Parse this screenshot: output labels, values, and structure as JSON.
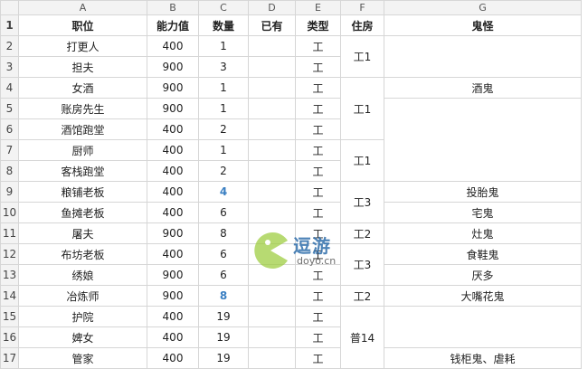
{
  "columns": [
    "A",
    "B",
    "C",
    "D",
    "E",
    "F",
    "G"
  ],
  "header": {
    "row_num": "1",
    "job": "职位",
    "ability": "能力值",
    "count": "数量",
    "owned": "已有",
    "type": "类型",
    "housing": "住房",
    "ghost": "鬼怪"
  },
  "rows": [
    {
      "n": "2",
      "job": "打更人",
      "ability": "400",
      "count": "1",
      "type": "工"
    },
    {
      "n": "3",
      "job": "担夫",
      "ability": "900",
      "count": "3",
      "type": "工"
    },
    {
      "n": "4",
      "job": "女酒",
      "ability": "900",
      "count": "1",
      "type": "工"
    },
    {
      "n": "5",
      "job": "账房先生",
      "ability": "900",
      "count": "1",
      "type": "工"
    },
    {
      "n": "6",
      "job": "酒馆跑堂",
      "ability": "400",
      "count": "2",
      "type": "工"
    },
    {
      "n": "7",
      "job": "厨师",
      "ability": "400",
      "count": "1",
      "type": "工"
    },
    {
      "n": "8",
      "job": "客栈跑堂",
      "ability": "400",
      "count": "2",
      "type": "工"
    },
    {
      "n": "9",
      "job": "粮铺老板",
      "ability": "400",
      "count": "4",
      "type": "工"
    },
    {
      "n": "10",
      "job": "鱼摊老板",
      "ability": "400",
      "count": "6",
      "type": "工"
    },
    {
      "n": "11",
      "job": "屠夫",
      "ability": "900",
      "count": "8",
      "type": "工"
    },
    {
      "n": "12",
      "job": "布坊老板",
      "ability": "400",
      "count": "6",
      "type": "工"
    },
    {
      "n": "13",
      "job": "绣娘",
      "ability": "900",
      "count": "6",
      "type": "工"
    },
    {
      "n": "14",
      "job": "冶炼师",
      "ability": "900",
      "count": "8",
      "type": "工"
    },
    {
      "n": "15",
      "job": "护院",
      "ability": "400",
      "count": "19",
      "type": "工"
    },
    {
      "n": "16",
      "job": "婢女",
      "ability": "400",
      "count": "19",
      "type": "工"
    },
    {
      "n": "17",
      "job": "管家",
      "ability": "400",
      "count": "19",
      "type": "工"
    }
  ],
  "housing": {
    "h1": "工1",
    "h2": "工1",
    "h3": "工1",
    "h4": "工3",
    "h5": "工2",
    "h6": "工3",
    "h7": "工2",
    "h8": "普14"
  },
  "ghosts": {
    "g4": "酒鬼",
    "g9": "投胎鬼",
    "g10": "宅鬼",
    "g11": "灶鬼",
    "g12": "食鞋鬼",
    "g13": "厌多",
    "g14": "大嘴花鬼",
    "g17": "钱柜鬼、虐耗"
  },
  "watermark": {
    "title": "逗游",
    "sub": "doyo.cn"
  },
  "colors": {
    "highlight_count": "#3a7fc2",
    "header_bg": "#f3f3f3",
    "grid_line": "#d6d6d6"
  }
}
